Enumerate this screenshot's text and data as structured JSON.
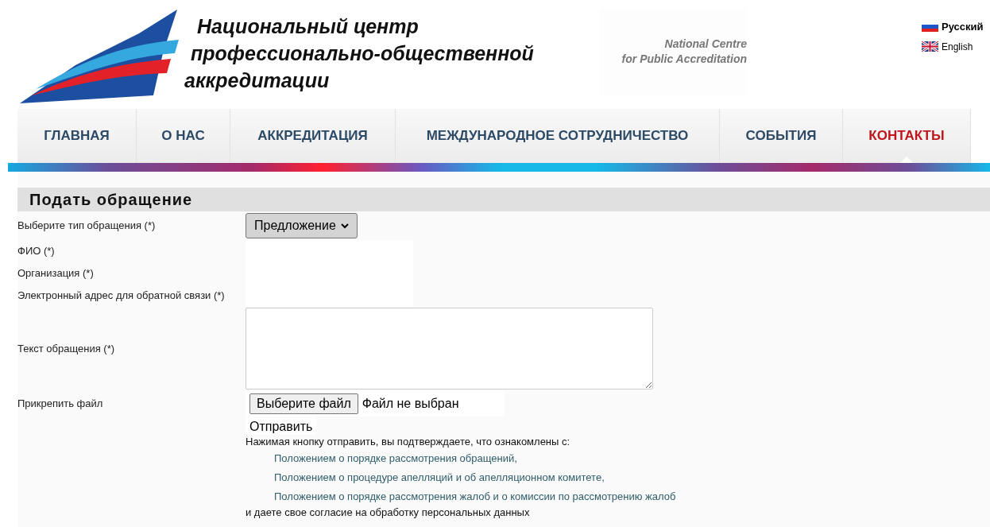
{
  "header": {
    "title_lines": [
      "Национальный центр",
      "профессионально-общественной",
      "аккредитации"
    ],
    "subtitle_lines": [
      "National Centre",
      "for Public Accreditation"
    ]
  },
  "languages": [
    {
      "label": "Русский",
      "kind": "ru",
      "selected": true
    },
    {
      "label": "English",
      "kind": "en",
      "selected": false
    }
  ],
  "nav": [
    {
      "label": "ГЛАВНАЯ",
      "selected": false
    },
    {
      "label": "О НАС",
      "selected": false
    },
    {
      "label": "АККРЕДИТАЦИЯ",
      "selected": false
    },
    {
      "label": "МЕЖДУНАРОДНОЕ СОТРУДНИЧЕСТВО",
      "selected": false
    },
    {
      "label": "СОБЫТИЯ",
      "selected": false
    },
    {
      "label": "КОНТАКТЫ",
      "selected": true
    }
  ],
  "form": {
    "title": "Подать обращение",
    "rows": [
      {
        "label": "Выберите тип обращения (*)",
        "kind": "select",
        "value": "Предложение"
      },
      {
        "label": "ФИО (*)",
        "kind": "input"
      },
      {
        "label": "Организация (*)",
        "kind": "input"
      },
      {
        "label": "Электронный адрес для обратной связи (*)",
        "kind": "input"
      },
      {
        "label": "Текст обращения (*)",
        "kind": "textarea"
      },
      {
        "label": "Прикрепить файл",
        "kind": "file",
        "button": "Выберите файл",
        "status": "Файл не выбран"
      }
    ],
    "submit": "Отправить",
    "notice": "Нажимая кнопку отправить, вы подтверждаете, что ознакомлены с:",
    "links": [
      "Положением о порядке рассмотрения обращений,",
      "Положением о процедуре апелляций и об апелляционном комитете,",
      "Положением о порядке рассмотрения жалоб и о комиссии по рассмотрению жалоб"
    ],
    "consent": "и даете свое согласие на обработку персональных данных"
  }
}
